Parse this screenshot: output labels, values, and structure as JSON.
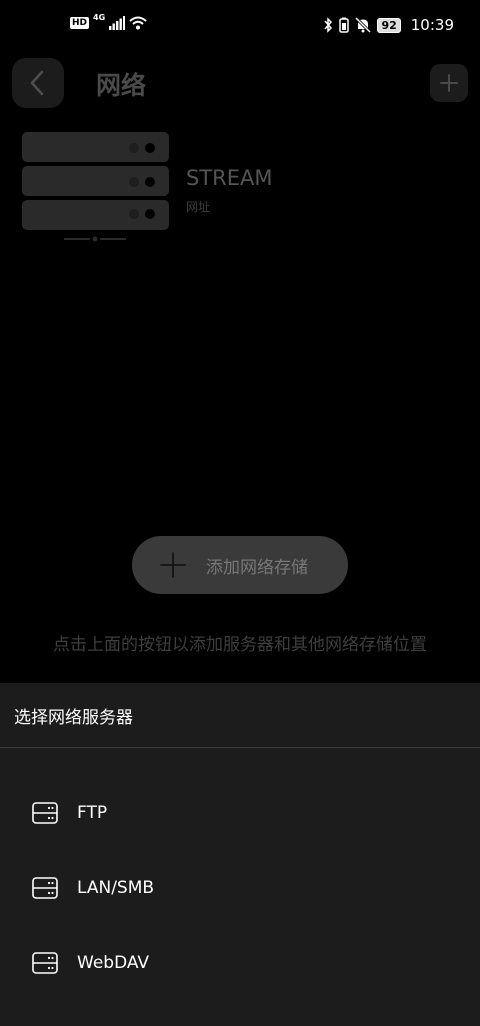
{
  "status_bar": {
    "hd": "HD",
    "network": "4G",
    "battery": "92",
    "time": "10:39"
  },
  "header": {
    "title": "网络"
  },
  "server": {
    "name": "STREAM",
    "subtitle": "网址"
  },
  "add_button": {
    "label": "添加网络存储"
  },
  "hint": "点击上面的按钮以添加服务器和其他网络存储位置",
  "sheet": {
    "title": "选择网络服务器",
    "items": [
      {
        "label": "FTP",
        "icon": "server-icon"
      },
      {
        "label": "LAN/SMB",
        "icon": "server-icon"
      },
      {
        "label": "WebDAV",
        "icon": "server-icon"
      }
    ]
  }
}
